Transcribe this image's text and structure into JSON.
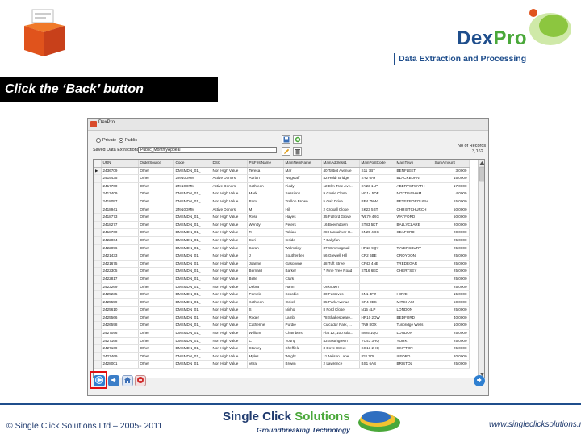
{
  "slide": {
    "instruction": "Click the ‘Back’ button",
    "logo_dex": "Dex",
    "logo_pro": "Pro",
    "tagline": "Data Extraction and Processing",
    "copyright": "© Single Click Solutions Ltd – 2005- 2011",
    "brand_single_click": "Single Click ",
    "brand_solutions": "Solutions",
    "brand_subtitle": "Groundbreaking Technology",
    "website": "www.singleclicksolutions.net"
  },
  "app": {
    "title": "DexPro",
    "private_label": "Private",
    "public_label": "Public",
    "selected_scope": "public",
    "saved_label": "Saved Data Extractions :",
    "saved_value": "Public_MonthlyAppeal",
    "records_label": "No of Records",
    "records_value": "3,162"
  },
  "grid": {
    "columns": [
      "URN",
      "OrderSource",
      "Code",
      "DSC",
      "PlsFirstName",
      "MainNemName",
      "MainAddress1",
      "MainPostCode",
      "MainTown",
      "SumAmount"
    ],
    "rows": [
      [
        "2436709",
        "Other",
        "DMSMDN_01_",
        "Non High Value",
        "Teresa",
        "Mar",
        "40 Talbot Avenue",
        "S11 7BT",
        "BENFLEET",
        "3.0000"
      ],
      [
        "2419435",
        "Other",
        "2Te10DMM",
        "Active Donors",
        "Adrian",
        "Wagstaff",
        "42 Holdr Bridge",
        "SY2 6AY",
        "BLACKBURN",
        "15.0000"
      ],
      [
        "2417700",
        "Other",
        "2Te10DMM",
        "Active Donors",
        "Kathleen",
        "Fiddy",
        "12 Elm Tree Ave...",
        "SY23 1LP",
        "ABERYSTWYTH",
        "17.0000"
      ],
      [
        "2417409",
        "Other",
        "DMSMDN_01_",
        "Non High Value",
        "Mark",
        "Sessions",
        "9 Corrie Close",
        "NG14 5DE",
        "NOTTINGHAM",
        "4.0000"
      ],
      [
        "2418057",
        "Other",
        "DMSMDN_01_",
        "Non High Value",
        "Pam",
        "Trellon Brown",
        "5 Oak Drive",
        "PE4 7NW",
        "PETERBOROUGH",
        "15.0000"
      ],
      [
        "2418941",
        "Other",
        "2Te10DMM",
        "Active Donors",
        "M",
        "Hill",
        "2 Croxall Close",
        "SK23 5BT",
        "CHRISTCHURCH",
        "50.0000"
      ],
      [
        "2418773",
        "Other",
        "DMSMDN_01_",
        "Non High Value",
        "Rose",
        "Hayes",
        "35 Falford Grove",
        "WL79 4XG",
        "WATFORD",
        "50.0000"
      ],
      [
        "2418277",
        "Other",
        "DMSMDN_01_",
        "Non High Value",
        "Wendy",
        "Peters",
        "16 Beechdown",
        "ST83 5KT",
        "BALLYCLARE",
        "20.0000"
      ],
      [
        "2418760",
        "Other",
        "DMSMDN_01_",
        "Non High Value",
        "R",
        "Tobias",
        "28 Hannahver H...",
        "SN25 4GG",
        "SEAFORD",
        "20.0000"
      ],
      [
        "2422064",
        "Other",
        "DMSMDN_01_",
        "Non High Value",
        "Ceri",
        "Inside",
        "7 Ballyfan",
        "",
        "",
        "25.0000"
      ],
      [
        "2422096",
        "Other",
        "DMSMDN_01_",
        "Non High Value",
        "Sarah",
        "Walmsley",
        "37 Wimmogmall",
        "HP18 9QY",
        "TYLERSBURY",
        "25.0000"
      ],
      [
        "2421433",
        "Other",
        "DMSMDN_01_",
        "Non High Value",
        "J",
        "Southerden",
        "56 Grewell Hill",
        "CR2 6BE",
        "CROYDON",
        "25.0000"
      ],
      [
        "2421675",
        "Other",
        "DMSMDN_01_",
        "Non High Value",
        "Joanne",
        "Gascoyne",
        "48 Tuft Street",
        "CF43 4NE",
        "TREDEGAR",
        "25.0000"
      ],
      [
        "2422305",
        "Other",
        "DMSMDN_01_",
        "Non High Value",
        "Bernard",
        "Barker",
        "7 Pine Tree Road",
        "ST16 6ED",
        "CHERTSEY",
        "25.0000"
      ],
      [
        "2422817",
        "Other",
        "DMSMDN_01_",
        "Non High Value",
        "Belle",
        "Clark",
        "",
        "",
        "",
        "25.0000"
      ],
      [
        "2423269",
        "Other",
        "DMSMDN_01_",
        "Non High Value",
        "Debra",
        "Hann",
        "Unknown",
        "",
        "",
        "25.0000"
      ],
      [
        "2425235",
        "Other",
        "DMSMDN_01_",
        "Non High Value",
        "Pamela",
        "Scasbie",
        "30 Fastoves",
        "SN1 4FZ",
        "HOVE",
        "15.0000"
      ],
      [
        "2425559",
        "Other",
        "DMSMDN_01_",
        "Non High Value",
        "Kathleen",
        "Ockell",
        "85 Park Avenue",
        "CR4 2ES",
        "MITCHAM",
        "50.0000"
      ],
      [
        "2425610",
        "Other",
        "DMSMDN_01_",
        "Non High Value",
        "S",
        "Nichol",
        "8 Ford Close",
        "N15 4LP",
        "LONDON",
        "25.0000"
      ],
      [
        "2425566",
        "Other",
        "DMSMDN_01_",
        "Non High Value",
        "Roger",
        "Lamb",
        "78 Shakespeare...",
        "HR10 2DW",
        "BEDFORD",
        "40.0000"
      ],
      [
        "2426598",
        "Other",
        "DMSMDN_01_",
        "Non High Value",
        "Catherine",
        "Purdie",
        "Culcadar Park, ...",
        "TN9 8GX",
        "Tunbridge Wells",
        "10.0000"
      ],
      [
        "2427096",
        "Other",
        "DMSMDN_01_",
        "Non High Value",
        "William",
        "Chambers",
        "Flat 12, 100 Atla...",
        "NW5 1QG",
        "LONDON",
        "25.0000"
      ],
      [
        "2427168",
        "Other",
        "DMSMDN_01_",
        "Non High Value",
        "C",
        "Young",
        "43 Southgreen",
        "YO43 3RQ",
        "YORK",
        "25.0000"
      ],
      [
        "2427169",
        "Other",
        "DMSMDN_01_",
        "Non High Value",
        "Stanley",
        "Sheffield",
        "3 Dove Street",
        "SO13 2HQ",
        "SKIPTON",
        "25.0000"
      ],
      [
        "2427469",
        "Other",
        "DMSMDN_01_",
        "Non High Value",
        "Myles",
        "Wright",
        "11 Nelson Lane",
        "IG8 7OL",
        "ILFORD",
        "20.0000"
      ],
      [
        "2428001",
        "Other",
        "DMSMDN_01_",
        "Non High Value",
        "Vera",
        "Brown",
        "2 Lawrence",
        "BS1 6AS",
        "BRISTOL",
        "25.0000"
      ]
    ]
  },
  "icons": {
    "back": "back-arrow-icon",
    "forward": "forward-arrow-icon",
    "home": "home-icon",
    "stop": "stop-icon",
    "next": "next-arrow-icon",
    "save": "save-icon",
    "delete": "delete-icon",
    "edit": "edit-icon",
    "refresh": "refresh-icon"
  },
  "colors": {
    "instruction_bg": "#000000",
    "brand_blue": "#1f4e8c",
    "brand_green": "#4aa83a",
    "highlight": "#e01010"
  }
}
